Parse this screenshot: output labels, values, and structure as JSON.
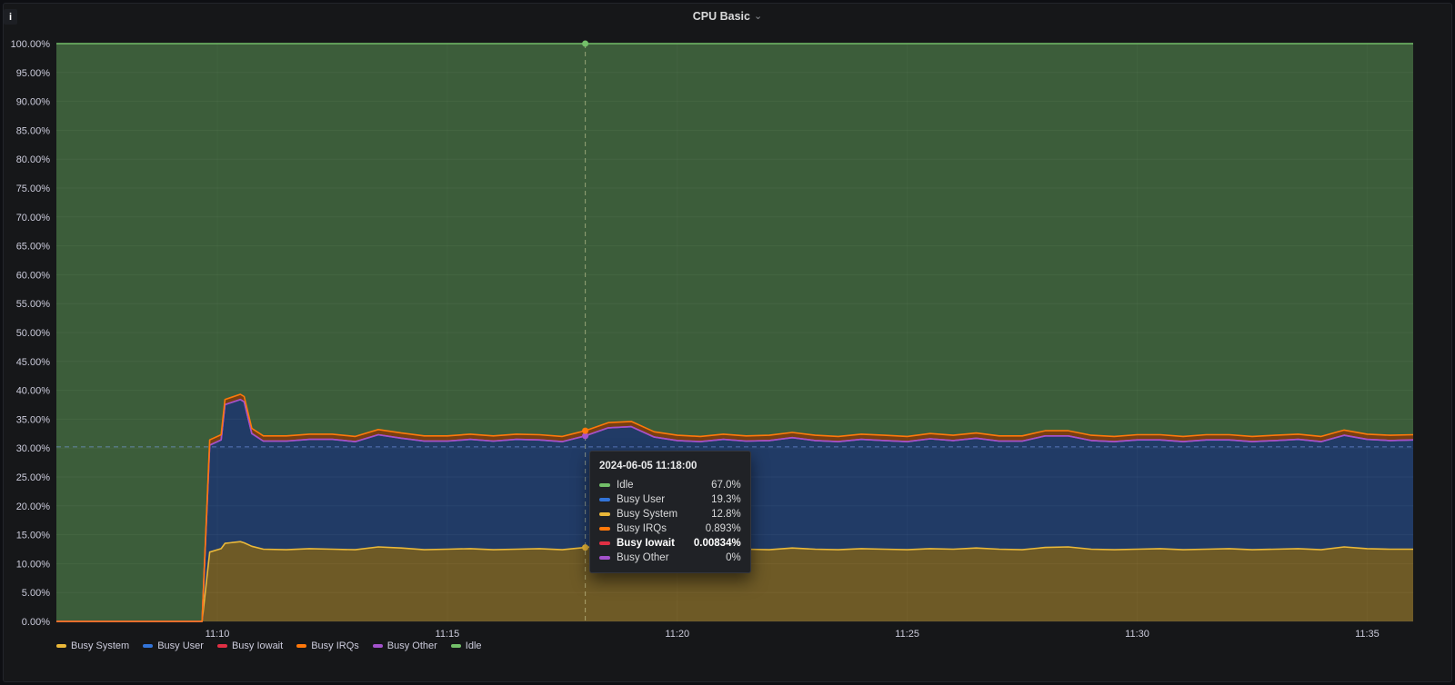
{
  "panel": {
    "title": "CPU Basic",
    "chevron_icon": "⌄",
    "info_icon": "i"
  },
  "tooltip": {
    "title": "2024-06-05 11:18:00",
    "rows": [
      {
        "label": "Idle",
        "value": "67.0%",
        "color": "#73BF69",
        "bold": false
      },
      {
        "label": "Busy User",
        "value": "19.3%",
        "color": "#3274D9",
        "bold": false
      },
      {
        "label": "Busy System",
        "value": "12.8%",
        "color": "#EAB839",
        "bold": false
      },
      {
        "label": "Busy IRQs",
        "value": "0.893%",
        "color": "#FF780A",
        "bold": false
      },
      {
        "label": "Busy Iowait",
        "value": "0.00834%",
        "color": "#E02F44",
        "bold": true
      },
      {
        "label": "Busy Other",
        "value": "0%",
        "color": "#A352CC",
        "bold": false
      }
    ]
  },
  "legend": [
    {
      "label": "Busy System",
      "color": "#EAB839"
    },
    {
      "label": "Busy User",
      "color": "#3274D9"
    },
    {
      "label": "Busy Iowait",
      "color": "#E02F44"
    },
    {
      "label": "Busy IRQs",
      "color": "#FF780A"
    },
    {
      "label": "Busy Other",
      "color": "#A352CC"
    },
    {
      "label": "Idle",
      "color": "#73BF69"
    }
  ],
  "chart_data": {
    "type": "area",
    "stacked": true,
    "title": "CPU Basic",
    "xlabel": "",
    "ylabel": "",
    "ylim": [
      0,
      100
    ],
    "grid": true,
    "legend_position": "bottom-left",
    "y_ticks": [
      "0.00%",
      "5.00%",
      "10.00%",
      "15.00%",
      "20.00%",
      "25.00%",
      "30.00%",
      "35.00%",
      "40.00%",
      "45.00%",
      "50.00%",
      "55.00%",
      "60.00%",
      "65.00%",
      "70.00%",
      "75.00%",
      "80.00%",
      "85.00%",
      "90.00%",
      "95.00%",
      "100.00%"
    ],
    "x_ticks": [
      {
        "label": "11:10",
        "t": 210
      },
      {
        "label": "11:15",
        "t": 510
      },
      {
        "label": "11:20",
        "t": 810
      },
      {
        "label": "11:25",
        "t": 1110
      },
      {
        "label": "11:30",
        "t": 1410
      },
      {
        "label": "11:35",
        "t": 1710
      }
    ],
    "x_range_seconds": [
      0,
      1770
    ],
    "times": [
      0,
      30,
      60,
      90,
      120,
      150,
      180,
      190,
      200,
      215,
      220,
      240,
      245,
      255,
      270,
      300,
      330,
      360,
      390,
      420,
      450,
      480,
      510,
      540,
      570,
      600,
      630,
      660,
      690,
      720,
      750,
      780,
      810,
      840,
      870,
      900,
      930,
      960,
      990,
      1020,
      1050,
      1080,
      1110,
      1140,
      1170,
      1200,
      1230,
      1260,
      1290,
      1320,
      1350,
      1380,
      1410,
      1440,
      1470,
      1500,
      1530,
      1560,
      1590,
      1620,
      1650,
      1680,
      1710,
      1740,
      1770
    ],
    "series": [
      {
        "name": "Busy System",
        "color": "#EAB839",
        "fill_opacity": 0.42,
        "values": [
          0,
          0,
          0,
          0,
          0,
          0,
          0,
          0,
          12.0,
          12.6,
          13.5,
          13.8,
          13.6,
          13.0,
          12.5,
          12.4,
          12.6,
          12.5,
          12.4,
          12.9,
          12.7,
          12.4,
          12.5,
          12.6,
          12.4,
          12.5,
          12.6,
          12.4,
          12.8,
          13.2,
          13.1,
          12.7,
          12.5,
          12.4,
          12.6,
          12.5,
          12.4,
          12.7,
          12.5,
          12.4,
          12.6,
          12.5,
          12.4,
          12.6,
          12.5,
          12.7,
          12.5,
          12.4,
          12.8,
          12.9,
          12.5,
          12.4,
          12.5,
          12.6,
          12.4,
          12.5,
          12.6,
          12.4,
          12.5,
          12.6,
          12.4,
          12.9,
          12.6,
          12.5,
          12.5
        ]
      },
      {
        "name": "Busy User",
        "color": "#3274D9",
        "fill_opacity": 0.4,
        "values": [
          0,
          0,
          0,
          0,
          0,
          0,
          0,
          0,
          18.5,
          18.8,
          24.0,
          24.6,
          24.4,
          19.5,
          18.7,
          18.8,
          18.9,
          19.0,
          18.7,
          19.4,
          19.0,
          18.8,
          18.7,
          18.9,
          18.8,
          19.0,
          18.8,
          18.7,
          19.3,
          20.3,
          20.6,
          19.2,
          18.8,
          18.7,
          18.9,
          18.7,
          18.9,
          19.1,
          18.8,
          18.7,
          18.9,
          18.8,
          18.7,
          19.0,
          18.8,
          19.0,
          18.7,
          18.8,
          19.3,
          19.2,
          18.8,
          18.7,
          18.9,
          18.8,
          18.7,
          18.9,
          18.8,
          18.7,
          18.8,
          18.9,
          18.7,
          19.3,
          18.9,
          18.8,
          18.9
        ]
      },
      {
        "name": "Busy Iowait",
        "color": "#E02F44",
        "fill_opacity": 0.42,
        "values": [
          0,
          0,
          0,
          0,
          0,
          0,
          0,
          0,
          0.01,
          0.01,
          0.01,
          0.01,
          0.01,
          0.01,
          0.01,
          0.01,
          0.01,
          0.01,
          0.01,
          0.01,
          0.01,
          0.01,
          0.01,
          0.01,
          0.01,
          0.01,
          0.01,
          0.01,
          0.00834,
          0.01,
          0.01,
          0.01,
          0.01,
          0.01,
          0.01,
          0.01,
          0.01,
          0.01,
          0.01,
          0.01,
          0.01,
          0.01,
          0.01,
          0.01,
          0.01,
          0.01,
          0.01,
          0.01,
          0.01,
          0.01,
          0.01,
          0.01,
          0.01,
          0.01,
          0.01,
          0.01,
          0.01,
          0.01,
          0.01,
          0.01,
          0.01,
          0.01,
          0.01,
          0.01,
          0.01
        ]
      },
      {
        "name": "Busy Other",
        "color": "#A352CC",
        "fill_opacity": 0.42,
        "values": [
          0,
          0,
          0,
          0,
          0,
          0,
          0,
          0,
          0,
          0,
          0,
          0,
          0,
          0,
          0,
          0,
          0,
          0,
          0,
          0,
          0,
          0,
          0,
          0,
          0,
          0,
          0,
          0,
          0,
          0,
          0,
          0,
          0,
          0,
          0,
          0,
          0,
          0,
          0,
          0,
          0,
          0,
          0,
          0,
          0,
          0,
          0,
          0,
          0,
          0,
          0,
          0,
          0,
          0,
          0,
          0,
          0,
          0,
          0,
          0,
          0,
          0,
          0,
          0,
          0
        ]
      },
      {
        "name": "Busy IRQs",
        "color": "#FF780A",
        "fill_opacity": 0.42,
        "values": [
          0,
          0,
          0,
          0,
          0,
          0,
          0,
          0,
          0.9,
          0.9,
          0.9,
          0.9,
          0.9,
          0.9,
          0.9,
          0.9,
          0.9,
          0.9,
          0.9,
          0.9,
          0.9,
          0.9,
          0.9,
          0.9,
          0.9,
          0.9,
          0.9,
          0.9,
          0.893,
          0.9,
          0.9,
          0.9,
          0.9,
          0.9,
          0.9,
          0.9,
          0.9,
          0.9,
          0.9,
          0.9,
          0.9,
          0.9,
          0.9,
          0.9,
          0.9,
          0.9,
          0.9,
          0.9,
          0.9,
          0.9,
          0.9,
          0.9,
          0.9,
          0.9,
          0.9,
          0.9,
          0.9,
          0.9,
          0.9,
          0.9,
          0.9,
          0.9,
          0.9,
          0.9,
          0.9
        ]
      },
      {
        "name": "Idle",
        "color": "#73BF69",
        "fill_opacity": 0.42,
        "values": null,
        "computed": "remainder_to_100"
      }
    ],
    "crosshair": {
      "t": 690,
      "cursor_percent": 30.2,
      "vline_color": "rgba(222,222,170,0.55)",
      "hline_color": "rgba(130,165,255,0.55)"
    }
  }
}
